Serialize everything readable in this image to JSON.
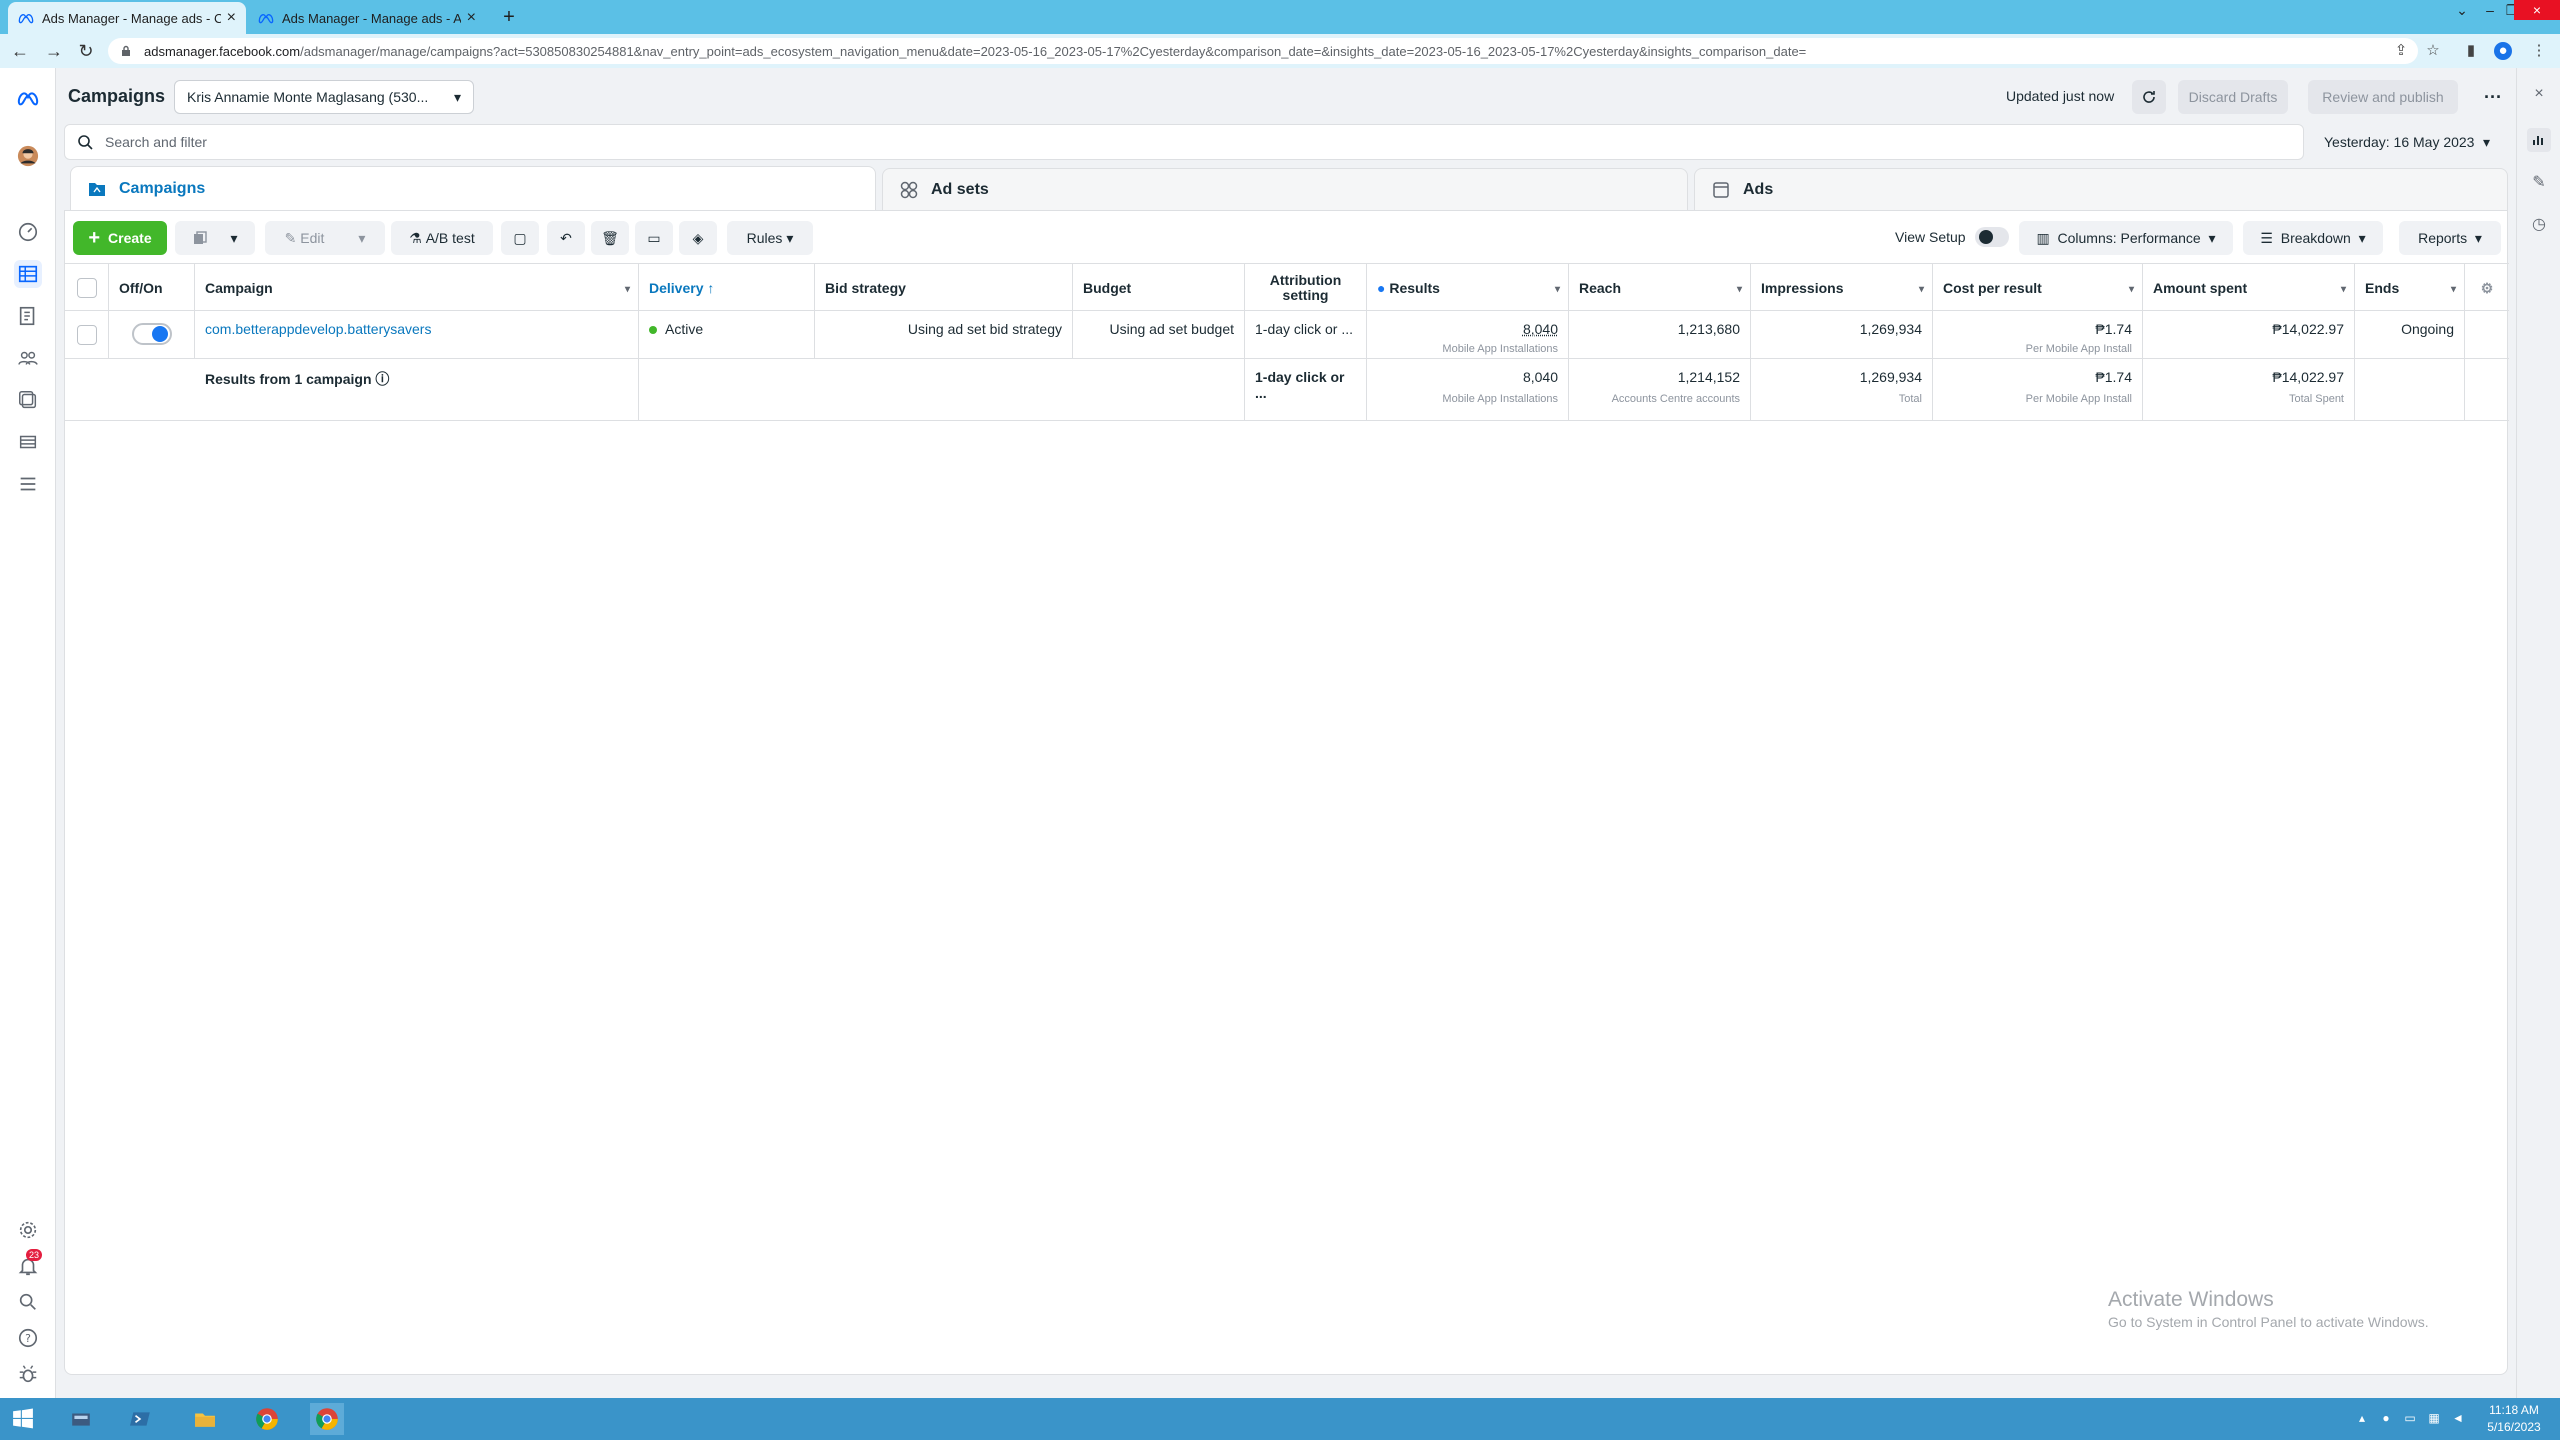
{
  "browser": {
    "tabs": [
      {
        "title": "Ads Manager - Manage ads - Ca",
        "active": true
      },
      {
        "title": "Ads Manager - Manage ads - Ac",
        "active": false
      }
    ],
    "new_tab": "+",
    "url_host": "adsmanager.facebook.com",
    "url_path": "/adsmanager/manage/campaigns?act=530850830254881&nav_entry_point=ads_ecosystem_navigation_menu&date=2023-05-16_2023-05-17%2Cyesterday&comparison_date=&insights_date=2023-05-16_2023-05-17%2Cyesterday&insights_comparison_date="
  },
  "header": {
    "title": "Campaigns",
    "account": "Kris Annamie Monte Maglasang (530...",
    "updated": "Updated just now",
    "discard_drafts": "Discard Drafts",
    "review_publish": "Review and publish",
    "more": "···"
  },
  "search": {
    "placeholder": "Search and filter",
    "date_range": "Yesterday: 16 May 2023"
  },
  "level_tabs": {
    "campaigns": "Campaigns",
    "adsets": "Ad sets",
    "ads": "Ads"
  },
  "toolbar": {
    "create": "Create",
    "edit": "Edit",
    "ab_test": "A/B test",
    "rules": "Rules",
    "view_setup": "View Setup",
    "columns": "Columns: Performance",
    "breakdown": "Breakdown",
    "reports": "Reports"
  },
  "table": {
    "headers": {
      "offon": "Off/On",
      "campaign": "Campaign",
      "delivery": "Delivery",
      "bid": "Bid strategy",
      "budget": "Budget",
      "attribution": "Attribution setting",
      "results": "Results",
      "reach": "Reach",
      "impressions": "Impressions",
      "cpr": "Cost per result",
      "spent": "Amount spent",
      "ends": "Ends"
    },
    "row": {
      "campaign": "com.betterappdevelop.batterysavers",
      "delivery": "Active",
      "bid": "Using ad set bid strategy",
      "budget": "Using ad set budget",
      "attribution": "1-day click or ...",
      "results": "8,040",
      "results_sub": "Mobile App Installations",
      "reach": "1,213,680",
      "impressions": "1,269,934",
      "cpr": "₱1.74",
      "cpr_sub": "Per Mobile App Install",
      "spent": "₱14,022.97",
      "ends": "Ongoing"
    },
    "summary": {
      "label": "Results from 1 campaign",
      "attribution": "1-day click or ...",
      "results": "8,040",
      "results_sub": "Mobile App Installations",
      "reach": "1,214,152",
      "reach_sub": "Accounts Centre accounts",
      "impressions": "1,269,934",
      "impressions_sub": "Total",
      "cpr": "₱1.74",
      "cpr_sub": "Per Mobile App Install",
      "spent": "₱14,022.97",
      "spent_sub": "Total Spent"
    }
  },
  "watermark": {
    "line1": "Activate Windows",
    "line2": "Go to System in Control Panel to activate Windows."
  },
  "nav": {
    "notification_count": "23"
  },
  "taskbar": {
    "time": "11:18 AM",
    "date": "5/16/2023"
  }
}
